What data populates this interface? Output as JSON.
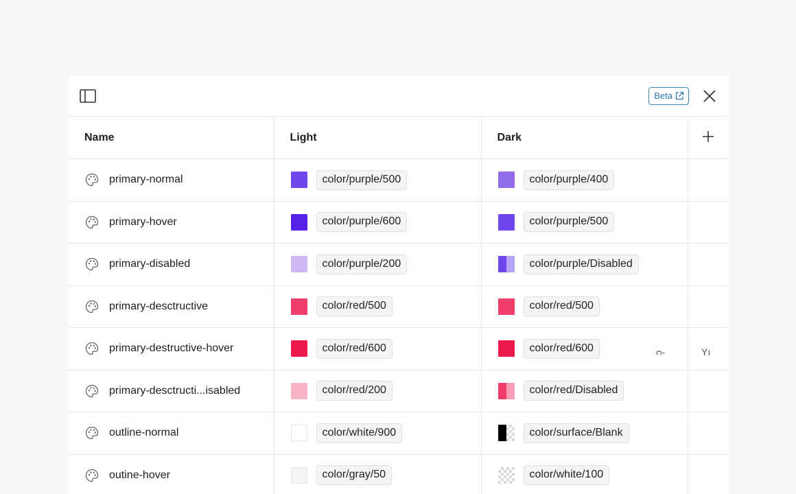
{
  "header": {
    "beta_label": "Beta"
  },
  "table": {
    "columns": {
      "name": "Name",
      "light": "Light",
      "dark": "Dark"
    },
    "rows": [
      {
        "name": "primary-normal",
        "light": {
          "label": "color/purple/500",
          "swatch": "#7047eb"
        },
        "dark": {
          "label": "color/purple/400",
          "swatch": "#916ceb"
        }
      },
      {
        "name": "primary-hover",
        "light": {
          "label": "color/purple/600",
          "swatch": "#5722e8"
        },
        "dark": {
          "label": "color/purple/500",
          "swatch": "#7047eb"
        }
      },
      {
        "name": "primary-disabled",
        "light": {
          "label": "color/purple/200",
          "swatch": "#cdb8f5"
        },
        "dark": {
          "label": "color/purple/Disabled",
          "swatch": "#7047eb"
        }
      },
      {
        "name": "primary-desctructive",
        "light": {
          "label": "color/red/500",
          "swatch": "#f03e6a"
        },
        "dark": {
          "label": "color/red/500",
          "swatch": "#f03e6a"
        }
      },
      {
        "name": "primary-destructive-hover",
        "light": {
          "label": "color/red/600",
          "swatch": "#ee1a4f"
        },
        "dark": {
          "label": "color/red/600",
          "swatch": "#ee1a4f"
        }
      },
      {
        "name": "primary-desctructi...isabled",
        "light": {
          "label": "color/red/200",
          "swatch": "#f7b2c3"
        },
        "dark": {
          "label": "color/red/Disabled",
          "swatch": "#f03e6a"
        }
      },
      {
        "name": "outline-normal",
        "light": {
          "label": "color/white/900",
          "swatch": "#ffffff"
        },
        "dark": {
          "label": "color/surface/Blank",
          "swatch": "#000000"
        }
      },
      {
        "name": "outine-hover",
        "light": {
          "label": "color/gray/50",
          "swatch": "#f4f4f4"
        },
        "dark": {
          "label": "color/white/100",
          "swatch": "#ffffff"
        }
      }
    ]
  },
  "artifacts": {
    "left": "ᴒ-",
    "right": "Yı"
  },
  "icons": {
    "sidebar": "sidebar-panel-icon",
    "external": "external-link-icon",
    "close": "close-icon",
    "add": "plus-icon",
    "token": "palette-icon"
  }
}
